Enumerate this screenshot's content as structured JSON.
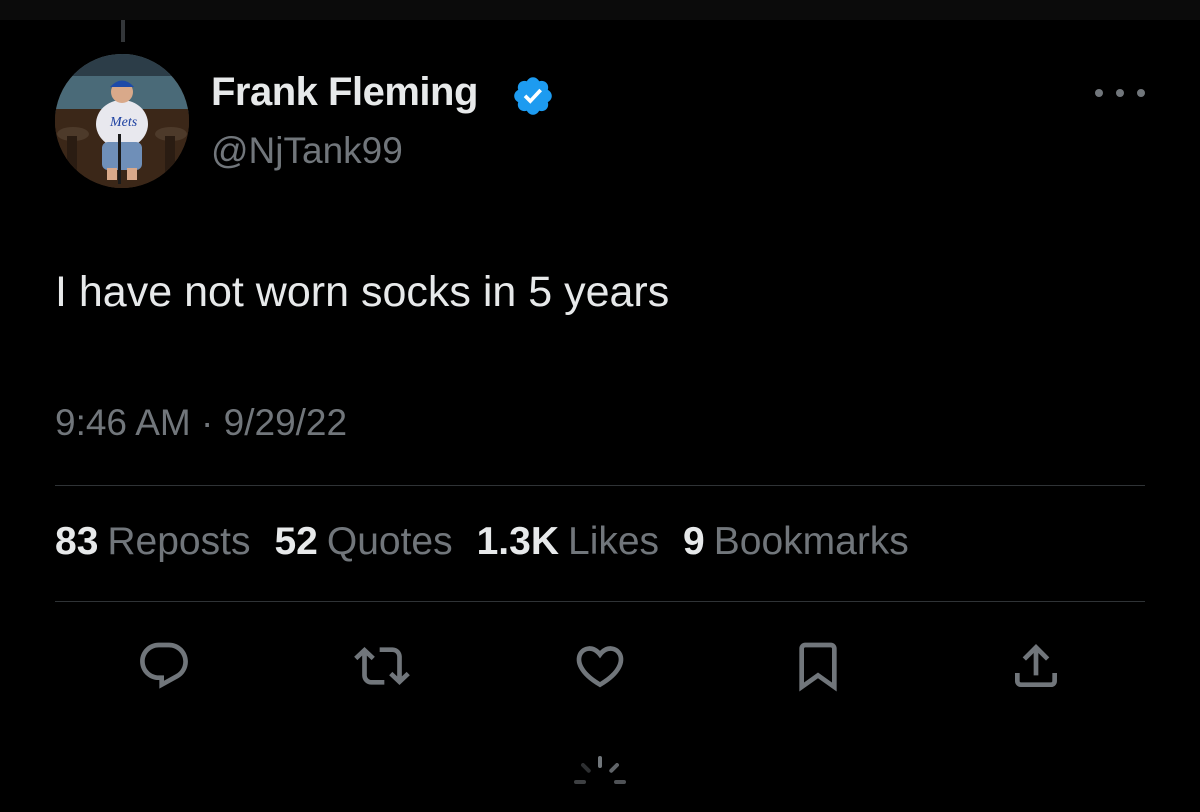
{
  "tweet": {
    "author": {
      "display_name": "Frank Fleming",
      "handle": "@NjTank99",
      "verified": true
    },
    "text": "I have not worn socks in 5 years",
    "timestamp": "9:46 AM · 9/29/22"
  },
  "stats": [
    {
      "count": "83",
      "label": "Reposts"
    },
    {
      "count": "52",
      "label": "Quotes"
    },
    {
      "count": "1.3K",
      "label": "Likes"
    },
    {
      "count": "9",
      "label": "Bookmarks"
    }
  ],
  "actions": [
    "reply-icon",
    "repost-icon",
    "like-icon",
    "bookmark-icon",
    "share-icon"
  ],
  "colors": {
    "background": "#000000",
    "primary_text": "#e7e9ea",
    "secondary_text": "#71767b",
    "divider": "#2f3336",
    "verified_badge": "#1d9bf0"
  }
}
